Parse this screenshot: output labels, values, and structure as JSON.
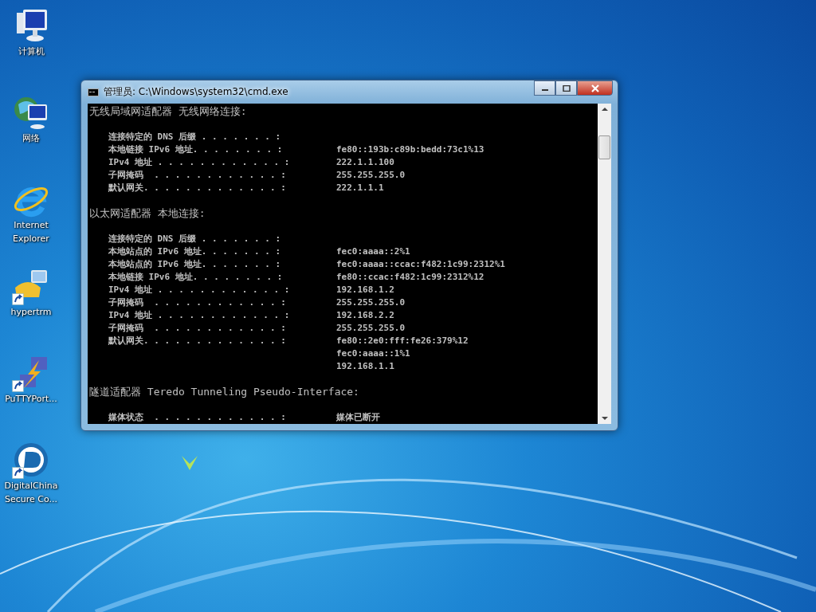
{
  "desktop_icons": [
    {
      "kind": "computer",
      "label": "计算机"
    },
    {
      "kind": "network",
      "label": "网络"
    },
    {
      "kind": "browser",
      "label": "Internet Explorer"
    },
    {
      "kind": "phone",
      "label": "hypertrm",
      "shortcut": true
    },
    {
      "kind": "bolt",
      "label": "PuTTYPort...",
      "shortcut": true
    },
    {
      "kind": "disc",
      "label": "DigitalChina Secure Co...",
      "shortcut": true
    }
  ],
  "window": {
    "title": "管理员: C:\\Windows\\system32\\cmd.exe",
    "sections": [
      {
        "heading": "无线局域网适配器 无线网络连接:",
        "entries": [
          {
            "label": "连接特定的 DNS 后缀 . . . . . . . :"
          },
          {
            "label": "本地链接 IPv6 地址. . . . . . . . :",
            "value": "fe80::193b:c89b:bedd:73c1%13"
          },
          {
            "label": "IPv4 地址 . . . . . . . . . . . . :",
            "value": "222.1.1.100"
          },
          {
            "label": "子网掩码  . . . . . . . . . . . . :",
            "value": "255.255.255.0"
          },
          {
            "label": "默认网关. . . . . . . . . . . . . :",
            "value": "222.1.1.1"
          }
        ]
      },
      {
        "heading": "以太网适配器 本地连接:",
        "entries": [
          {
            "label": "连接特定的 DNS 后缀 . . . . . . . :"
          },
          {
            "label": "本地站点的 IPv6 地址. . . . . . . :",
            "value": "fec0:aaaa::2%1"
          },
          {
            "label": "本地站点的 IPv6 地址. . . . . . . :",
            "value": "fec0:aaaa::ccac:f482:1c99:2312%1"
          },
          {
            "label": "本地链接 IPv6 地址. . . . . . . . :",
            "value": "fe80::ccac:f482:1c99:2312%12"
          },
          {
            "label": "IPv4 地址 . . . . . . . . . . . . :",
            "value": "192.168.1.2"
          },
          {
            "label": "子网掩码  . . . . . . . . . . . . :",
            "value": "255.255.255.0"
          },
          {
            "label": "IPv4 地址 . . . . . . . . . . . . :",
            "value": "192.168.2.2"
          },
          {
            "label": "子网掩码  . . . . . . . . . . . . :",
            "value": "255.255.255.0"
          },
          {
            "label": "默认网关. . . . . . . . . . . . . :",
            "value": "fe80::2e0:fff:fe26:379%12"
          },
          {
            "value": "fec0:aaaa::1%1"
          },
          {
            "value": "192.168.1.1"
          }
        ]
      },
      {
        "heading": "隧道适配器 Teredo Tunneling Pseudo-Interface:",
        "entries": [
          {
            "label": "媒体状态  . . . . . . . . . . . . :",
            "value": "媒体已断开"
          }
        ]
      }
    ]
  }
}
